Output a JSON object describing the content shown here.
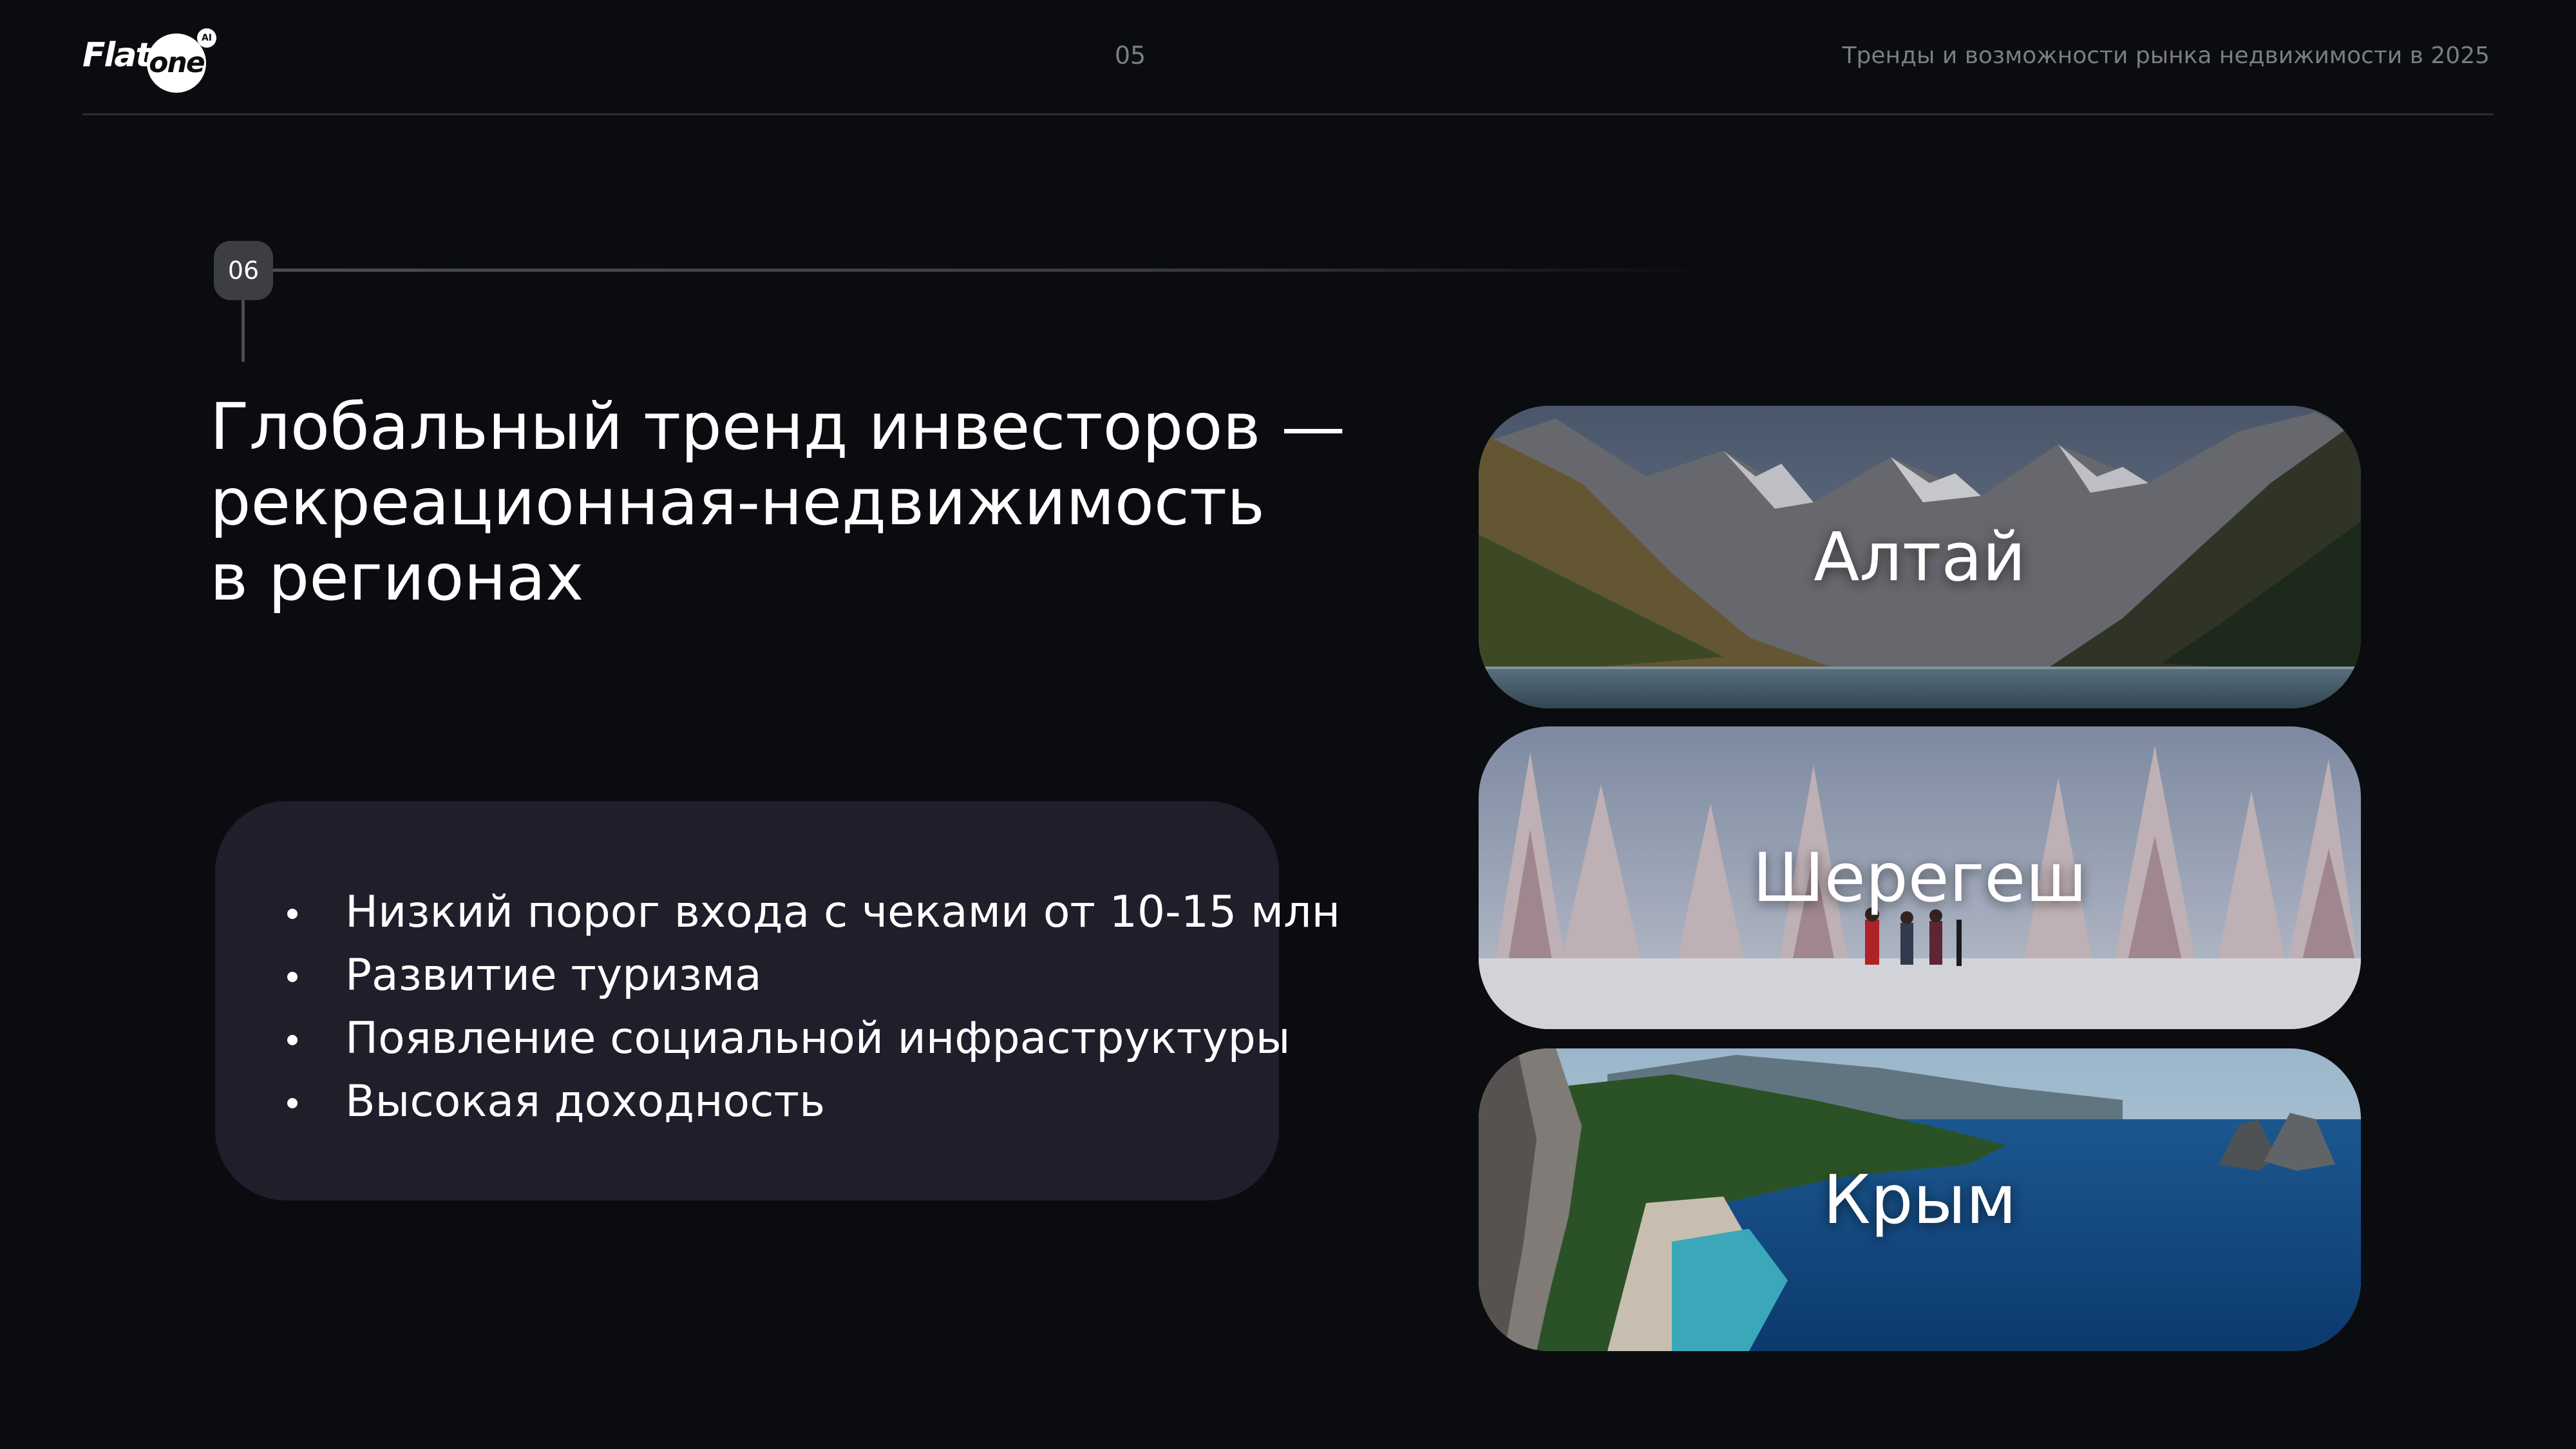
{
  "header": {
    "logo": {
      "word": "Flat",
      "circle_word": "one",
      "badge": "AI"
    },
    "page_number": "05",
    "title": "Тренды и возможности рынка недвижимости в 2025"
  },
  "section": {
    "number": "06",
    "headline_lines": [
      "Глобальный тренд инвесторов —",
      "рекреационная-недвижимость",
      "в регионах"
    ]
  },
  "bullets": [
    "Низкий порог входа с чеками от 10-15 млн",
    "Развитие туризма",
    "Появление социальной инфраструктуры",
    "Высокая доходность"
  ],
  "regions": [
    {
      "name": "Алтай",
      "scene": "mountain-lake-photo"
    },
    {
      "name": "Шерегеш",
      "scene": "snowy-forest-skiers-photo"
    },
    {
      "name": "Крым",
      "scene": "sea-coast-photo"
    }
  ],
  "colors": {
    "background": "#0b0c10",
    "card": "#1e1f2a",
    "muted_text": "#7b7d84",
    "badge": "#3c3e44"
  }
}
